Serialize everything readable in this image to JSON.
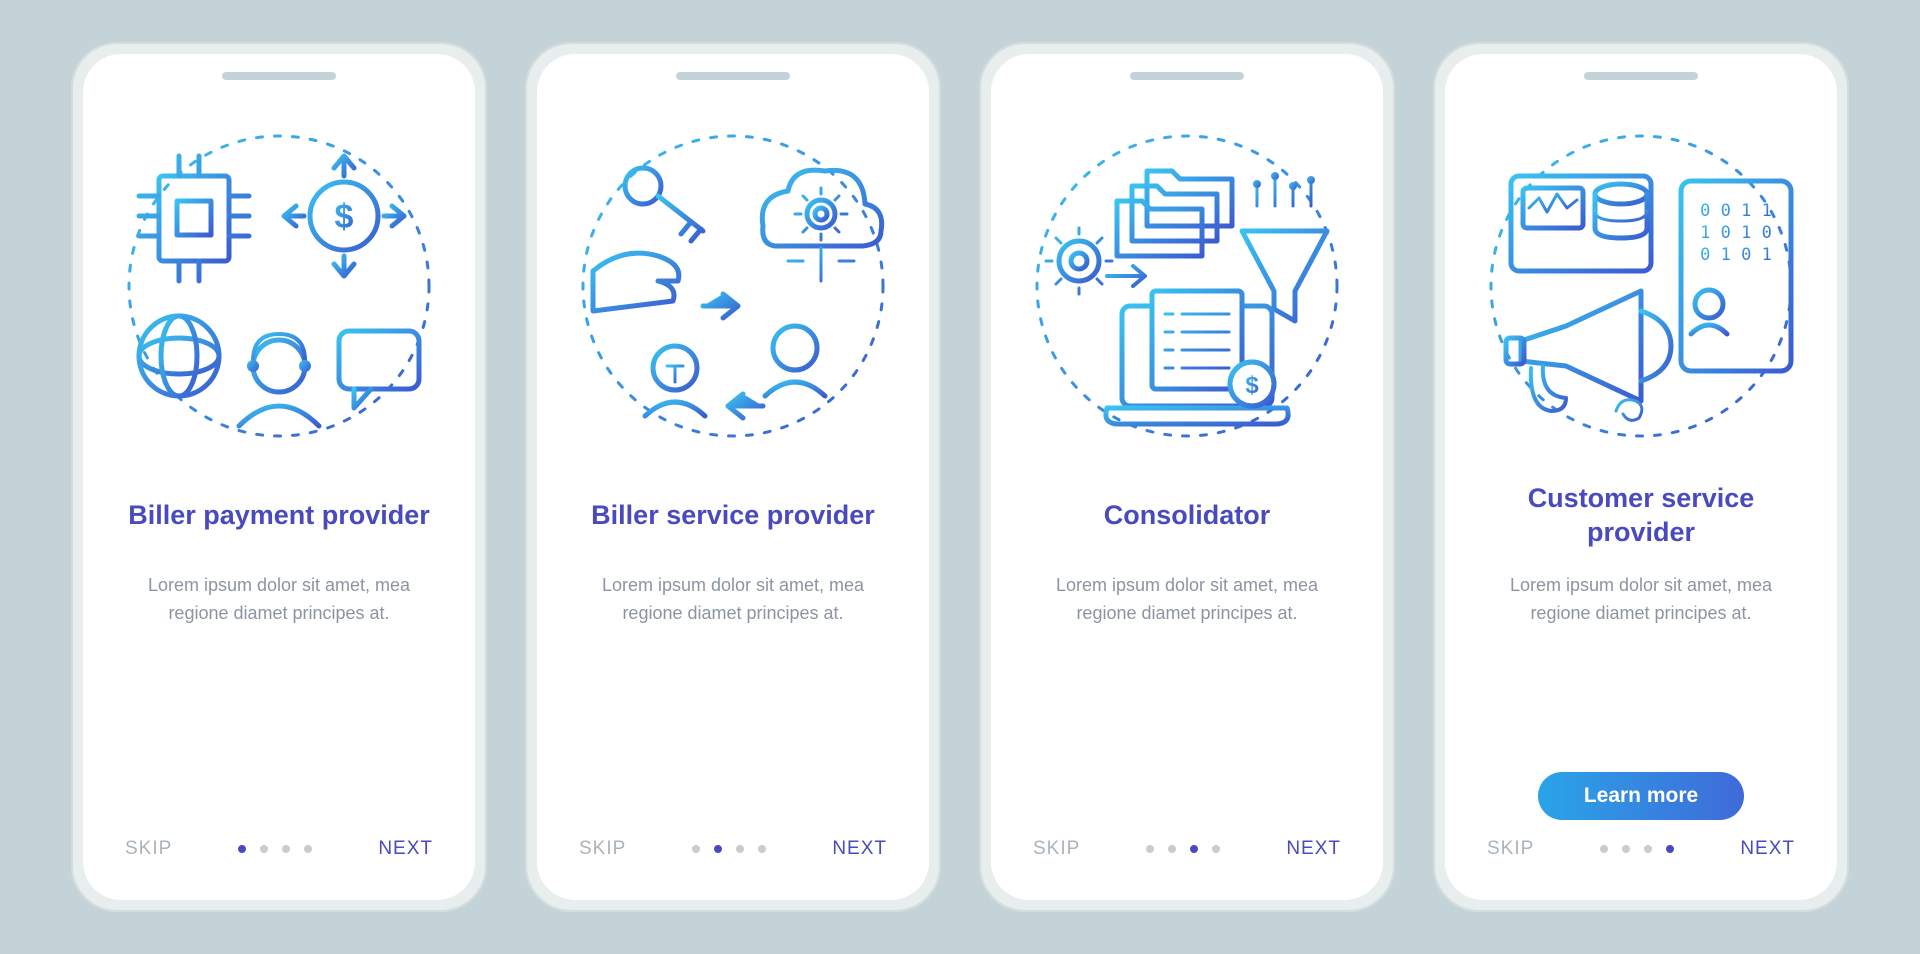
{
  "colors": {
    "title": "#4a4abf",
    "gradStart": "#39c3f0",
    "gradEnd": "#3b5bd0",
    "muted": "#8b95a1",
    "skip": "#aab3bc"
  },
  "nav": {
    "skip_label": "SKIP",
    "next_label": "NEXT",
    "dotCount": 4
  },
  "learnMoreLabel": "Learn more",
  "screens": [
    {
      "id": "biller-payment",
      "title": "Biller payment provider",
      "description": "Lorem ipsum dolor sit amet, mea regione diamet principes at.",
      "hasLearnMore": false,
      "activeDot": 0,
      "icons": [
        "chip-document-icon",
        "dollar-arrows-icon",
        "globe-icon",
        "support-agent-icon",
        "chat-bubble-icon"
      ]
    },
    {
      "id": "biller-service",
      "title": "Biller service provider",
      "description": "Lorem ipsum dolor sit amet, mea regione diamet principes at.",
      "hasLearnMore": false,
      "activeDot": 1,
      "icons": [
        "key-icon",
        "hand-icon",
        "cloud-gear-icon",
        "users-exchange-icon",
        "arrow-right-icon",
        "arrow-left-icon"
      ]
    },
    {
      "id": "consolidator",
      "title": "Consolidator",
      "description": "Lorem ipsum dolor sit amet, mea regione diamet principes at.",
      "hasLearnMore": false,
      "activeDot": 2,
      "icons": [
        "folders-icon",
        "gear-icon",
        "funnel-icon",
        "laptop-checklist-icon",
        "dollar-badge-icon"
      ]
    },
    {
      "id": "customer-service",
      "title": "Customer service provider",
      "description": "Lorem ipsum dolor sit amet, mea regione diamet principes at.",
      "hasLearnMore": true,
      "activeDot": 3,
      "icons": [
        "dashboard-card-icon",
        "database-icon",
        "megaphone-icon",
        "tablet-binary-icon",
        "profile-icon"
      ]
    }
  ]
}
